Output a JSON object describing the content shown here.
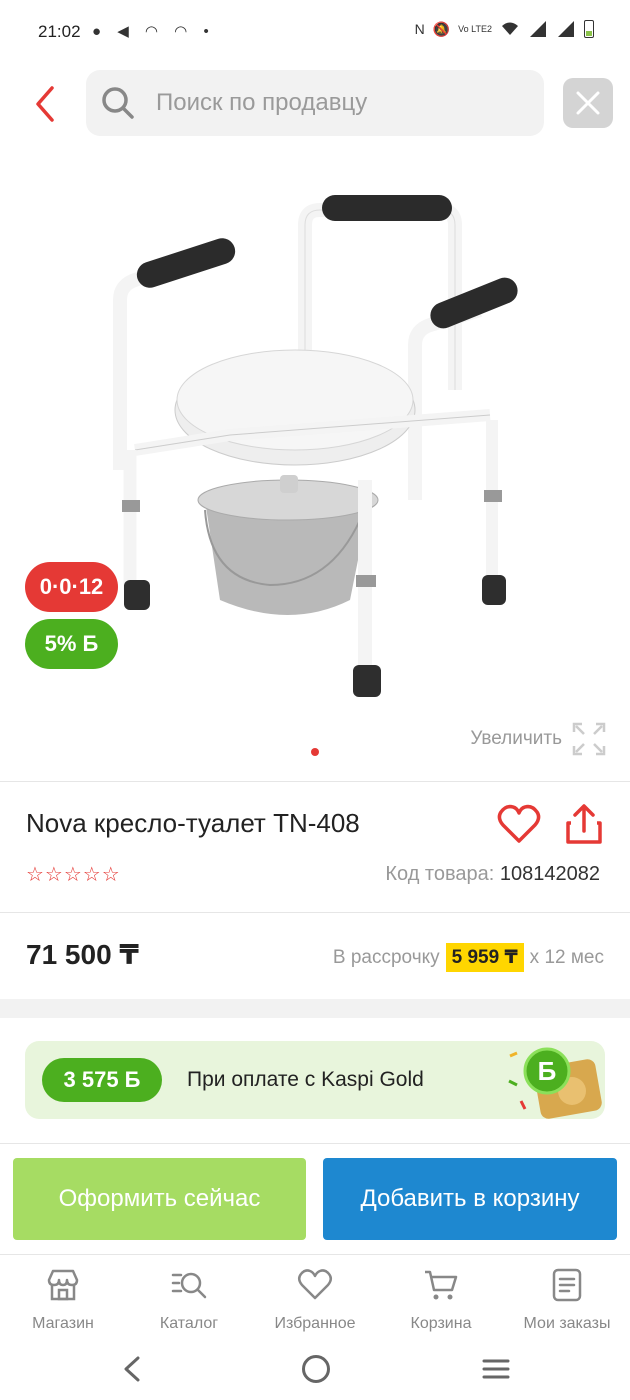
{
  "status_bar": {
    "time": "21:02",
    "left_icons": "● ◀ ◠ ◠ •",
    "right_icons": [
      "nfc-icon",
      "mute-icon",
      "volte-icon",
      "wifi-icon",
      "signal-icon",
      "signal-icon",
      "battery-icon"
    ],
    "volte_text": "Vo LTE2"
  },
  "header": {
    "search_placeholder": "Поиск по продавцу"
  },
  "product": {
    "badge_installment": "0·0·12",
    "badge_bonus": "5% Б",
    "zoom_label": "Увеличить",
    "title": "Nova кресло-туалет TN-408",
    "rating_stars": "☆☆☆☆☆",
    "sku_label": "Код товара:",
    "sku_value": "108142082",
    "price": "71 500 ₸",
    "installment_prefix": "В рассрочку",
    "installment_amount": "5 959 ₸",
    "installment_suffix": "x 12 мес"
  },
  "kaspi_gold": {
    "bonus_amount": "3 575 Б",
    "text": "При оплате с Kaspi Gold"
  },
  "actions": {
    "buy_now": "Оформить сейчас",
    "add_to_cart": "Добавить в корзину"
  },
  "bottom_nav": {
    "items": [
      {
        "label": "Магазин",
        "icon": "shop-icon"
      },
      {
        "label": "Каталог",
        "icon": "catalog-search-icon"
      },
      {
        "label": "Избранное",
        "icon": "heart-icon"
      },
      {
        "label": "Корзина",
        "icon": "cart-icon"
      },
      {
        "label": "Мои заказы",
        "icon": "orders-icon"
      }
    ]
  },
  "colors": {
    "accent_red": "#e53935",
    "bonus_green": "#4caf1f",
    "buy_now_green": "#a6dc63",
    "cart_blue": "#1e88d0",
    "installment_yellow": "#ffd600"
  }
}
